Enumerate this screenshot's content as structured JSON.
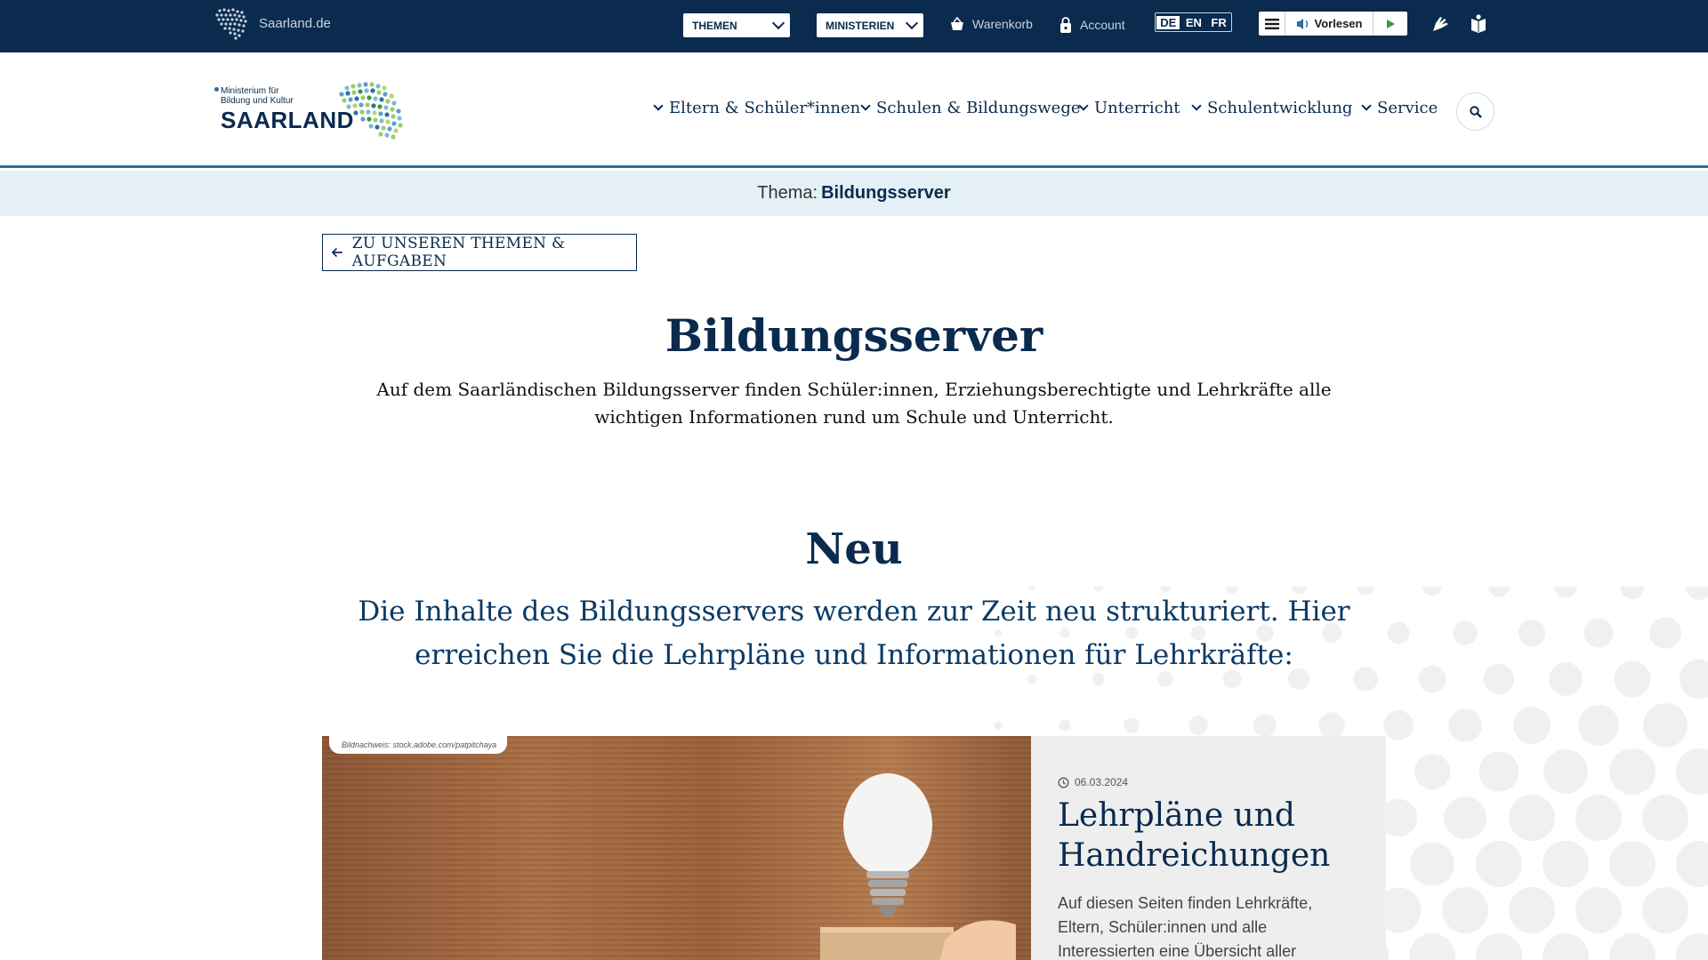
{
  "topbar": {
    "brand": "Saarland.de",
    "select_themen": "THEMEN",
    "select_ministerien": "MINISTERIEN",
    "cart": "Warenkorb",
    "account": "Account",
    "languages": [
      "DE",
      "EN",
      "FR"
    ],
    "active_language": "DE",
    "reader_label": "Vorlesen",
    "icons": [
      "sign-language-icon",
      "easy-language-icon"
    ]
  },
  "header": {
    "logo_line1": "Ministerium für",
    "logo_line2": "Bildung und Kultur",
    "logo_brand": "SAARLAND",
    "nav": [
      {
        "label": "Eltern & Schüler*innen"
      },
      {
        "label": "Schulen & Bildungswege"
      },
      {
        "label": "Unterricht"
      },
      {
        "label": "Schulentwicklung"
      },
      {
        "label": "Service"
      }
    ]
  },
  "thema": {
    "prefix": "Thema:",
    "value": "Bildungsserver"
  },
  "back_button": "ZU UNSEREN THEMEN & AUFGABEN",
  "main": {
    "title": "Bildungsserver",
    "lead": "Auf dem Saarländischen Bildungsserver finden Schüler:innen, Erziehungsberechtigte und Lehrkräfte alle wichtigen Informationen rund um Schule und Unterricht.",
    "section_title": "Neu",
    "section_sub": "Die Inhalte des Bildungsservers werden zur Zeit neu strukturiert. Hier erreichen Sie die Lehrpläne und Informationen für Lehrkräfte:"
  },
  "card": {
    "credit": "Bildnachweis: stock.adobe.com/patpitchaya",
    "date": "06.03.2024",
    "title": "Lehrpläne und Handreichungen",
    "text": "Auf diesen Seiten finden Lehrkräfte, Eltern, Schüler:innen und alle Interessierten eine Übersicht aller"
  },
  "colors": {
    "navy": "#0a2a4e",
    "band": "#e4f0f5",
    "accent": "#2f6fa3"
  }
}
